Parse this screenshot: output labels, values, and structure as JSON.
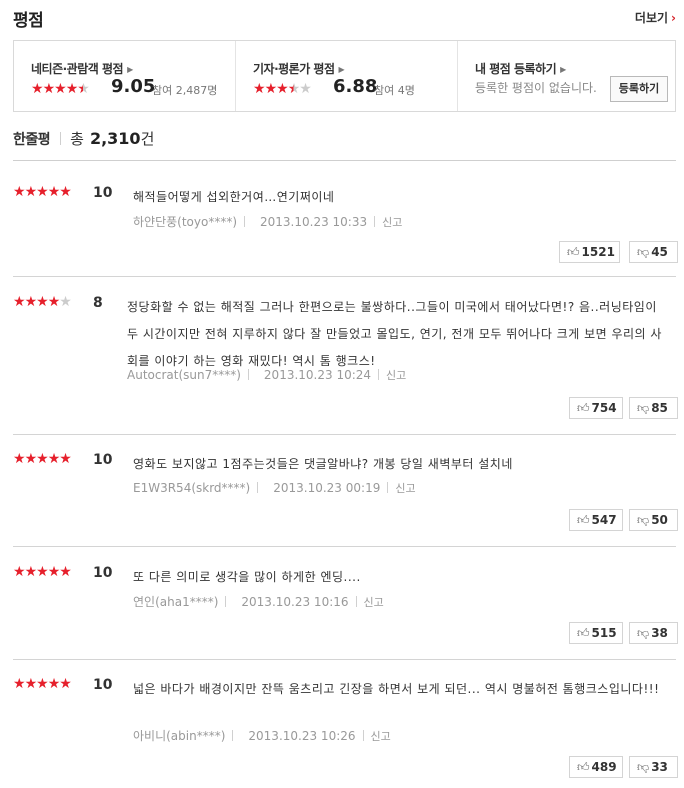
{
  "header": {
    "title": "평점",
    "more_label": "더보기",
    "more_chevron": "›"
  },
  "score_box": {
    "netizen": {
      "label": "네티즌·관람객 평점",
      "rating": 4.5,
      "score": "9.05",
      "participants": "참여 2,487명"
    },
    "critic": {
      "label": "기자·평론가 평점",
      "rating": 3.5,
      "score": "6.88",
      "participants": "참여 4명"
    },
    "mine": {
      "label": "내 평점 등록하기",
      "description": "등록한 평점이 없습니다.",
      "register_label": "등록하기"
    }
  },
  "count": {
    "label": "한줄평",
    "prefix": "총",
    "value": "2,310",
    "suffix": "건"
  },
  "reviews": [
    {
      "rating": 5,
      "score": "10",
      "text": "해적들어떻게 섭외한거여…연기쩌이네",
      "author": "하얀단풍(toyo****)",
      "date": "2013.10.23 10:33",
      "report": "신고",
      "likes": "1521",
      "dislikes": "45"
    },
    {
      "rating": 4,
      "score": "8",
      "text": "정당화할 수 없는 해적질 그러나 한편으로는 불쌍하다..그들이 미국에서 태어났다면!? 음..러닝타임이 두 시간이지만 전혀 지루하지 않다 잘 만들었고 몰입도, 연기, 전개 모두 뛰어나다 크게 보면 우리의 사회를 이야기 하는 영화 재밌다! 역시 톰 행크스!",
      "author": "Autocrat(sun7****)",
      "date": "2013.10.23 10:24",
      "report": "신고",
      "likes": "754",
      "dislikes": "85"
    },
    {
      "rating": 5,
      "score": "10",
      "text": "영화도 보지않고 1점주는것들은 댓글알바냐? 개봉 당일 새벽부터 설치네",
      "author": "E1W3R54(skrd****)",
      "date": "2013.10.23 00:19",
      "report": "신고",
      "likes": "547",
      "dislikes": "50"
    },
    {
      "rating": 5,
      "score": "10",
      "text": "또 다른 의미로 생각을 많이 하게한 엔딩....",
      "author": "연인(aha1****)",
      "date": "2013.10.23 10:16",
      "report": "신고",
      "likes": "515",
      "dislikes": "38"
    },
    {
      "rating": 5,
      "score": "10",
      "text": "넓은 바다가 배경이지만 잔뜩 움츠리고 긴장을 하면서 보게 되던... 역시 명불허전 톰행크스입니다!!!",
      "author": "아비니(abin****)",
      "date": "2013.10.23 10:26",
      "report": "신고",
      "likes": "489",
      "dislikes": "33"
    }
  ],
  "icons": {
    "star": "★",
    "like": "thumbs-up-icon",
    "dislike": "thumbs-down-icon"
  },
  "colors": {
    "star_on": "#e6202c",
    "star_off": "#cccccc",
    "accent": "#d6262d"
  }
}
